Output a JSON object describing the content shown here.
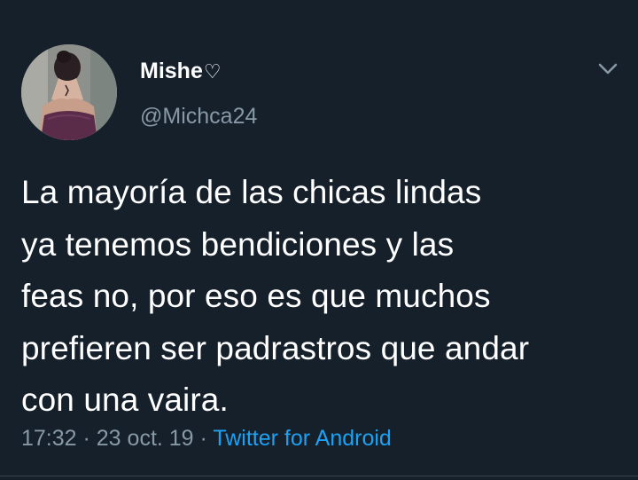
{
  "tweet": {
    "display_name": "Mishe",
    "name_symbol": "♡",
    "handle": "@Michca24",
    "text": "La mayoría de las chicas lindas\nya tenemos bendiciones y las\nfeas no, por eso es que muchos\nprefieren ser padrastros que andar\ncon una vaira.",
    "time": "17:32",
    "separator": " · ",
    "date": "23 oct. 19",
    "source": "Twitter for Android"
  },
  "icons": {
    "avatar": "profile-photo",
    "menu": "chevron-down-icon"
  },
  "colors": {
    "background": "#15202b",
    "primary_text": "#ffffff",
    "secondary_text": "#8899a6",
    "link": "#1da1f2"
  }
}
